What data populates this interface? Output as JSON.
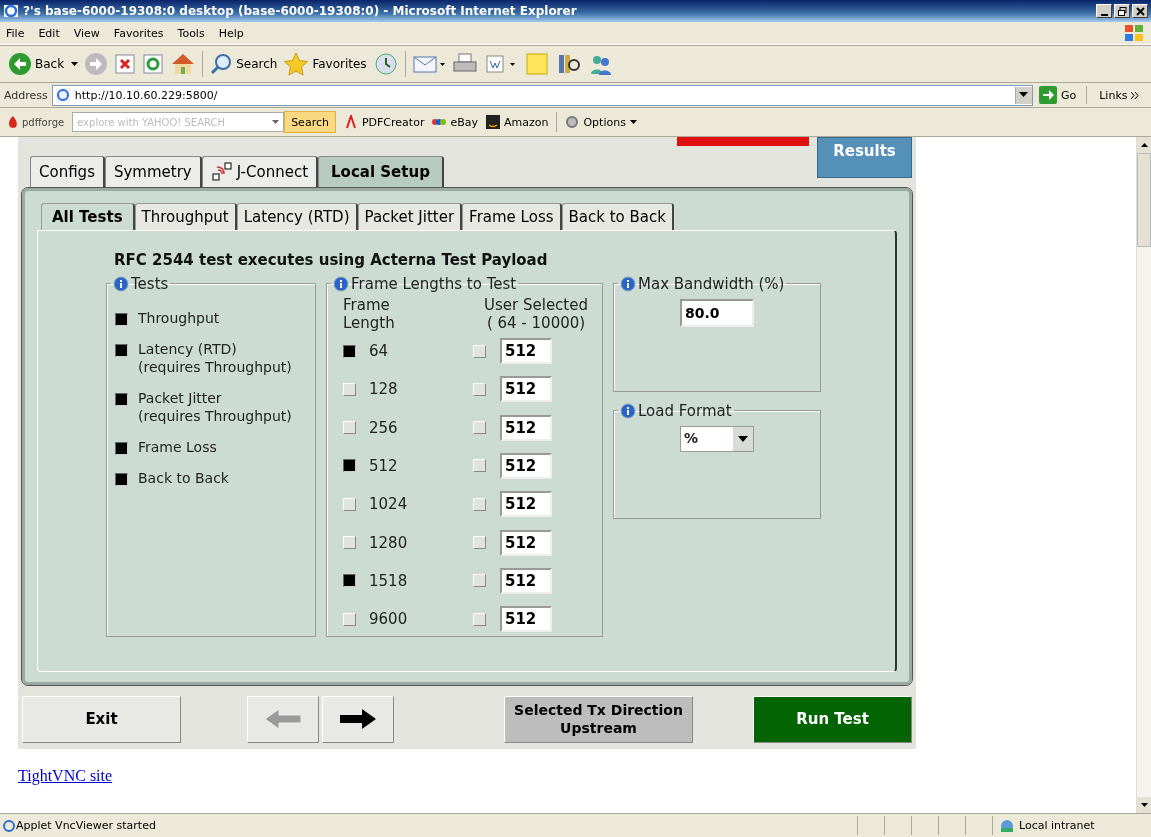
{
  "window": {
    "title": "?'s base-6000-19308:0 desktop (base-6000-19308:0) - Microsoft Internet Explorer"
  },
  "menu_bar": [
    "File",
    "Edit",
    "View",
    "Favorites",
    "Tools",
    "Help"
  ],
  "toolbar": {
    "back": "Back",
    "search": "Search",
    "favorites": "Favorites"
  },
  "address_bar": {
    "label": "Address",
    "value": "http://10.10.60.229:5800/",
    "go": "Go",
    "links": "Links"
  },
  "links_toolbar": {
    "brand": "pdfforge",
    "placeholder": "explore with YAHOO! SEARCH",
    "search": "Search",
    "items": [
      "PDFCreator",
      "eBay",
      "Amazon"
    ],
    "options": "Options"
  },
  "applet": {
    "results": "Results",
    "tabs": [
      {
        "label": "Configs",
        "selected": false,
        "has_icon": false
      },
      {
        "label": "Symmetry",
        "selected": false,
        "has_icon": false
      },
      {
        "label": "J-Connect",
        "selected": false,
        "has_icon": true
      },
      {
        "label": "Local Setup",
        "selected": true,
        "has_icon": false
      }
    ],
    "sub_tabs": [
      {
        "label": "All Tests",
        "selected": true
      },
      {
        "label": "Throughput",
        "selected": false
      },
      {
        "label": "Latency (RTD)",
        "selected": false
      },
      {
        "label": "Packet Jitter",
        "selected": false
      },
      {
        "label": "Frame Loss",
        "selected": false
      },
      {
        "label": "Back to Back",
        "selected": false
      }
    ],
    "heading": "RFC 2544 test executes using Acterna Test Payload",
    "tests": {
      "title": "Tests",
      "items": [
        {
          "label": "Throughput",
          "checked": true
        },
        {
          "label": "Latency (RTD)",
          "note": "(requires Throughput)",
          "checked": true
        },
        {
          "label": "Packet Jitter",
          "note": "(requires Throughput)",
          "checked": true
        },
        {
          "label": "Frame Loss",
          "checked": true
        },
        {
          "label": "Back to Back",
          "checked": true
        }
      ]
    },
    "frame_lengths": {
      "title": "Frame Lengths to Test",
      "col_1": [
        "Frame",
        "Length"
      ],
      "col_2": [
        "User Selected",
        "( 64  - 10000)"
      ],
      "rows": [
        {
          "length": "64",
          "checked": true,
          "user_checked": false,
          "value": "512"
        },
        {
          "length": "128",
          "checked": false,
          "user_checked": false,
          "value": "512"
        },
        {
          "length": "256",
          "checked": false,
          "user_checked": false,
          "value": "512"
        },
        {
          "length": "512",
          "checked": true,
          "user_checked": false,
          "value": "512"
        },
        {
          "length": "1024",
          "checked": false,
          "user_checked": false,
          "value": "512"
        },
        {
          "length": "1280",
          "checked": false,
          "user_checked": false,
          "value": "512"
        },
        {
          "length": "1518",
          "checked": true,
          "user_checked": false,
          "value": "512"
        },
        {
          "length": "9600",
          "checked": false,
          "user_checked": false,
          "value": "512"
        }
      ]
    },
    "max_bandwidth": {
      "title": "Max Bandwidth (%)",
      "value": "80.0"
    },
    "load_format": {
      "title": "Load Format",
      "value": "%"
    },
    "buttons": {
      "exit": "Exit",
      "back_disabled": true,
      "forward_disabled": false,
      "direction": [
        "Selected Tx Direction",
        "Upstream"
      ],
      "run": "Run Test"
    }
  },
  "page_link": "TightVNC site",
  "status_bar": {
    "text": "Applet VncViewer started",
    "zone": "Local intranet"
  }
}
